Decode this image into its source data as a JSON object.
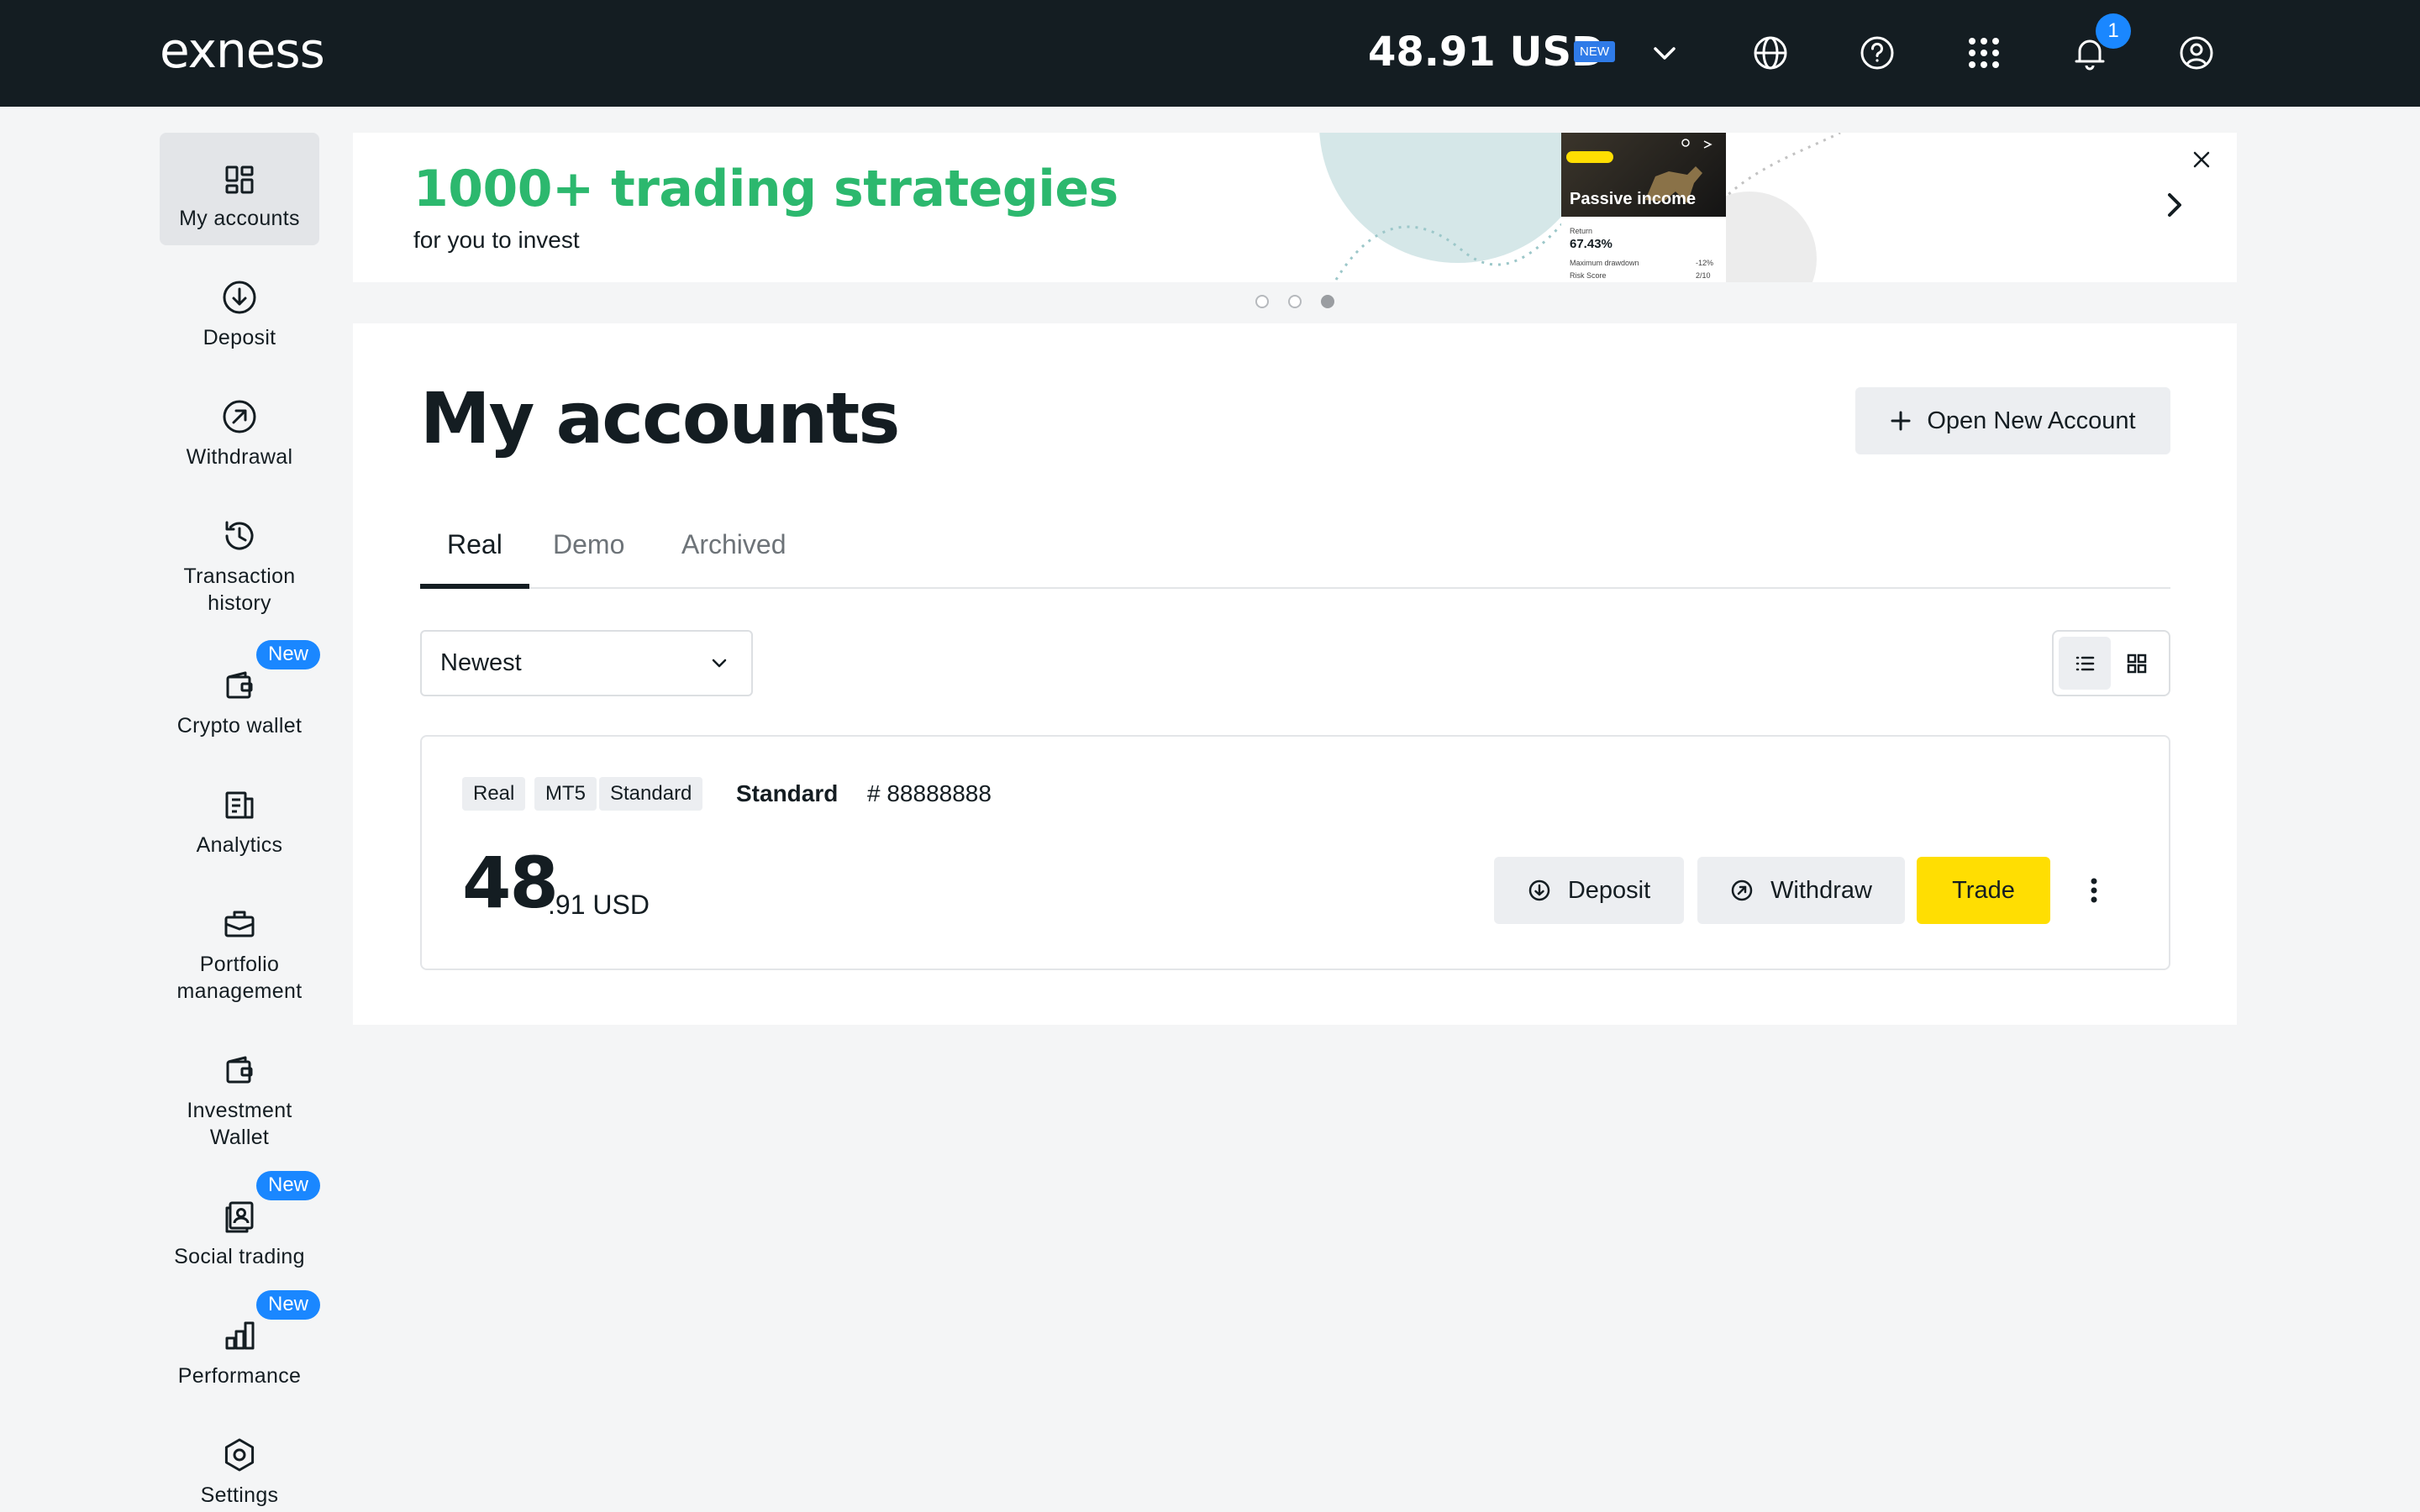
{
  "header": {
    "logo": "exness",
    "balance": "48.91 USD",
    "balance_badge": "NEW",
    "notification_count": "1",
    "icons": [
      "chevron-down-icon",
      "globe-icon",
      "help-icon",
      "apps-grid-icon",
      "bell-icon",
      "user-profile-icon"
    ]
  },
  "sidebar": {
    "items": [
      {
        "label": "My accounts",
        "icon": "dashboard-icon",
        "active": true
      },
      {
        "label": "Deposit",
        "icon": "deposit-icon"
      },
      {
        "label": "Withdrawal",
        "icon": "withdrawal-icon"
      },
      {
        "label": "Transaction",
        "label2": "history",
        "icon": "history-icon"
      },
      {
        "label": "Crypto wallet",
        "icon": "wallet-icon",
        "badge": "New"
      },
      {
        "label": "Analytics",
        "icon": "analytics-icon"
      },
      {
        "label": "Portfolio",
        "label2": "management",
        "icon": "briefcase-icon"
      },
      {
        "label": "Investment",
        "label2": "Wallet",
        "icon": "wallet-icon"
      },
      {
        "label": "Social trading",
        "icon": "social-trading-icon",
        "badge": "New"
      },
      {
        "label": "Performance",
        "icon": "bar-chart-icon",
        "badge": "New"
      },
      {
        "label": "Settings",
        "icon": "settings-icon"
      }
    ]
  },
  "banner": {
    "title": "1000+ trading strategies",
    "subtitle": "for you to invest",
    "card_title": "Passive income",
    "card_return_label": "Return",
    "card_return": "67.43%",
    "card_drawdown_label": "Maximum drawdown",
    "card_drawdown": "-12%",
    "card_risk_label": "Risk Score",
    "card_risk": "2/10",
    "active_dot": 3
  },
  "main": {
    "title": "My accounts",
    "open_account_label": "Open New Account",
    "tabs": [
      "Real",
      "Demo",
      "Archived"
    ],
    "active_tab": "Real",
    "sort_value": "Newest"
  },
  "account": {
    "tags": [
      "Real",
      "MT5",
      "Standard"
    ],
    "name": "Standard",
    "number": "# 88888888",
    "balance_int": "48",
    "balance_frac": ".91 USD",
    "deposit_label": "Deposit",
    "withdraw_label": "Withdraw",
    "trade_label": "Trade"
  },
  "colors": {
    "header_bg": "#141d22",
    "brand_green": "#2cb86e",
    "trade_yellow": "#ffde02",
    "badge_blue": "#1a87ff"
  }
}
